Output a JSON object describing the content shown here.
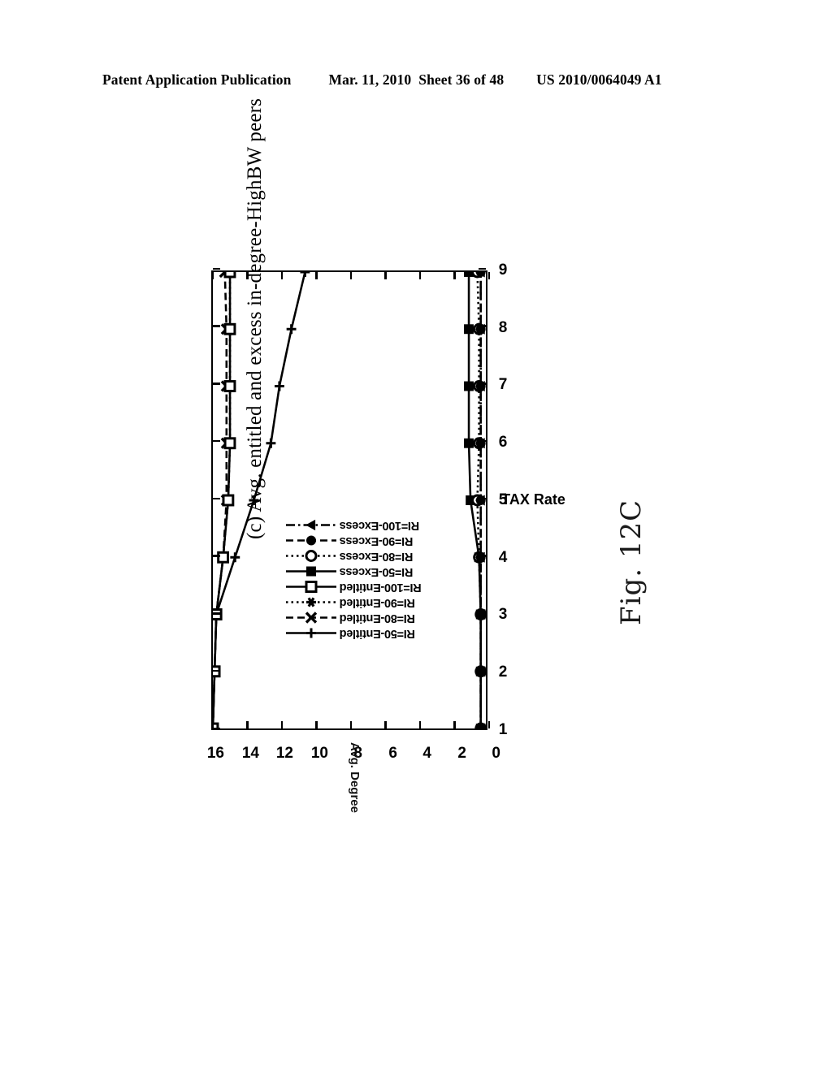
{
  "header": {
    "publication": "Patent Application Publication",
    "date": "Mar. 11, 2010",
    "sheet": "Sheet 36 of 48",
    "document_number": "US 2010/0064049 A1"
  },
  "figure": {
    "caption": "(c) Avg. entitled and excess in-degree-HighBW peers",
    "handwritten_number": "Fig. 12C",
    "rotation": "90-degrees-counterclockwise"
  },
  "chart_data": {
    "type": "line",
    "title": "",
    "xlabel": "TAX Rate",
    "ylabel": "Avg. Degree",
    "x": [
      1,
      2,
      3,
      4,
      5,
      6,
      7,
      8,
      9
    ],
    "xlim": [
      1,
      9
    ],
    "ylim": [
      0,
      16
    ],
    "xticks": [
      "1",
      "2",
      "3",
      "4",
      "5",
      "6",
      "7",
      "8",
      "9"
    ],
    "yticks": [
      "0",
      "2",
      "4",
      "6",
      "8",
      "10",
      "12",
      "14",
      "16"
    ],
    "grid": false,
    "legend_position": "center",
    "series": [
      {
        "name": "RI=50-Entitled",
        "marker": "plus-icon",
        "line_style": "solid",
        "values": [
          16.0,
          15.9,
          15.8,
          14.7,
          13.6,
          12.6,
          12.1,
          11.4,
          10.6
        ]
      },
      {
        "name": "RI=80-Entitled",
        "marker": "x-icon",
        "line_style": "dashed",
        "values": [
          16.0,
          15.9,
          15.8,
          15.4,
          15.2,
          15.2,
          15.2,
          15.2,
          15.3
        ]
      },
      {
        "name": "RI=90-Entitled",
        "marker": "star-icon",
        "line_style": "dotted",
        "values": [
          16.0,
          15.9,
          15.8,
          15.4,
          15.1,
          15.0,
          15.0,
          15.0,
          15.0
        ]
      },
      {
        "name": "RI=100-Entitled",
        "marker": "open-square-icon",
        "line_style": "solid",
        "values": [
          16.0,
          15.9,
          15.8,
          15.4,
          15.1,
          15.0,
          15.0,
          15.0,
          15.0
        ]
      },
      {
        "name": "RI=50-Excess",
        "marker": "filled-square-icon",
        "line_style": "solid",
        "values": [
          0.3,
          0.3,
          0.3,
          0.4,
          0.9,
          1.0,
          1.0,
          1.0,
          1.0
        ]
      },
      {
        "name": "RI=80-Excess",
        "marker": "open-circle-icon",
        "line_style": "dotted",
        "values": [
          0.3,
          0.3,
          0.3,
          0.4,
          0.5,
          0.4,
          0.4,
          0.4,
          0.5
        ]
      },
      {
        "name": "RI=90-Excess",
        "marker": "filled-circle-icon",
        "line_style": "dashed",
        "values": [
          0.3,
          0.3,
          0.3,
          0.3,
          0.3,
          0.3,
          0.3,
          0.3,
          0.3
        ]
      },
      {
        "name": "RI=100-Excess",
        "marker": "filled-triangle-icon",
        "line_style": "dash-dot",
        "values": [
          0.3,
          0.3,
          0.3,
          0.3,
          0.3,
          0.3,
          0.3,
          0.3,
          0.3
        ]
      }
    ]
  }
}
